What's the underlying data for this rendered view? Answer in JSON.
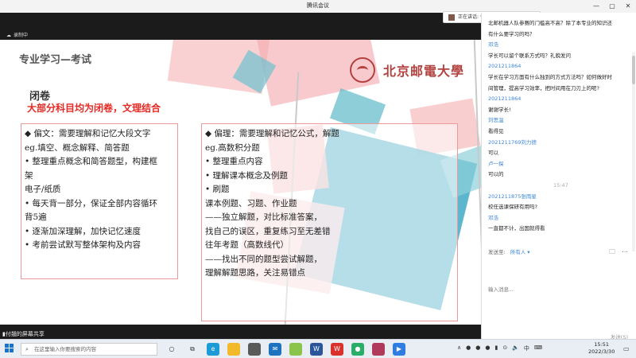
{
  "window": {
    "title": "腾讯会议",
    "controls": [
      "—",
      "▢",
      "✕"
    ]
  },
  "speaker": {
    "label": "正在讲话: 付翘"
  },
  "recording": {
    "label": "录制中",
    "icon": "cloud-icon"
  },
  "slide": {
    "title": "专业学习—考试",
    "logo_text": "北京邮電大學",
    "closed_label": "闭卷",
    "closed_note": "大部分科目均为闭卷，文理结合",
    "left_box": [
      "◆ 偏文：需要理解和记忆大段文字",
      "eg.填空、概念解释、简答题",
      "• 整理重点概念和简答题型，构建框",
      "    架",
      "  电子/纸质",
      "• 每天背一部分，保证全部内容循环",
      "    背5遍",
      "• 逐渐加深理解，加快记忆速度",
      "• 考前尝试默写整体架构及内容"
    ],
    "right_box": [
      "◆ 偏理：需要理解和记忆公式，解题",
      "eg.高数积分题",
      "• 整理重点内容",
      "• 理解课本概念及例题",
      "• 刷题",
      "   课本例题、习题、作业题",
      "   ——独立解题，对比标准答案，",
      "       找自己的误区，重复练习至无差错",
      "   往年考题（高数线代）",
      "       ——找出不同的题型尝试解题，",
      "           理解解题思路，关注易错点"
    ]
  },
  "share_bar": {
    "label": "付翘的屏幕共享"
  },
  "chat": {
    "messages": [
      {
        "text": "北邮机器人队参赛的门槛高不高？除了本专业的知识还",
        "kind": "msg"
      },
      {
        "text": "有什么要学习的吗？",
        "kind": "msg"
      },
      {
        "text": "邓浩",
        "kind": "name"
      },
      {
        "text": "学长可以留个联系方式吗？礼貌发问",
        "kind": "msg"
      },
      {
        "text": "2021211864",
        "kind": "name"
      },
      {
        "text": "学长在学习方面有什么独到的方式方法吗？如何做好时",
        "kind": "msg"
      },
      {
        "text": "间管理，提高学习效率，把时间用在刀刃上的呢?",
        "kind": "msg"
      },
      {
        "text": "2021211864",
        "kind": "name"
      },
      {
        "text": "谢谢学长!",
        "kind": "msg"
      },
      {
        "text": "刘思温",
        "kind": "name"
      },
      {
        "text": "看得见",
        "kind": "msg"
      },
      {
        "text": "2021211769刘力德",
        "kind": "name"
      },
      {
        "text": "可以",
        "kind": "msg"
      },
      {
        "text": "卢一探",
        "kind": "name"
      },
      {
        "text": "可以的",
        "kind": "msg"
      },
      {
        "text": "15:47",
        "kind": "ts"
      },
      {
        "text": "2021211875张雨星",
        "kind": "name"
      },
      {
        "text": "校任选课保研有用吗?",
        "kind": "msg"
      },
      {
        "text": "邓浩",
        "kind": "name"
      },
      {
        "text": "一直都不计，出国就得看",
        "kind": "msg"
      }
    ],
    "send_to_label": "发送至:",
    "send_to_value": "所有人 ▾",
    "input_placeholder": "输入消息...",
    "send_button": "发送(S)"
  },
  "taskbar": {
    "search_placeholder": "在这里输入你要搜索的内容",
    "tray_ime": "中",
    "clock_time": "15:51",
    "clock_date": "2022/3/30"
  },
  "colors": {
    "accent_red": "#e52a24",
    "logo_red": "#b2423f",
    "link_blue": "#3d86d6"
  }
}
